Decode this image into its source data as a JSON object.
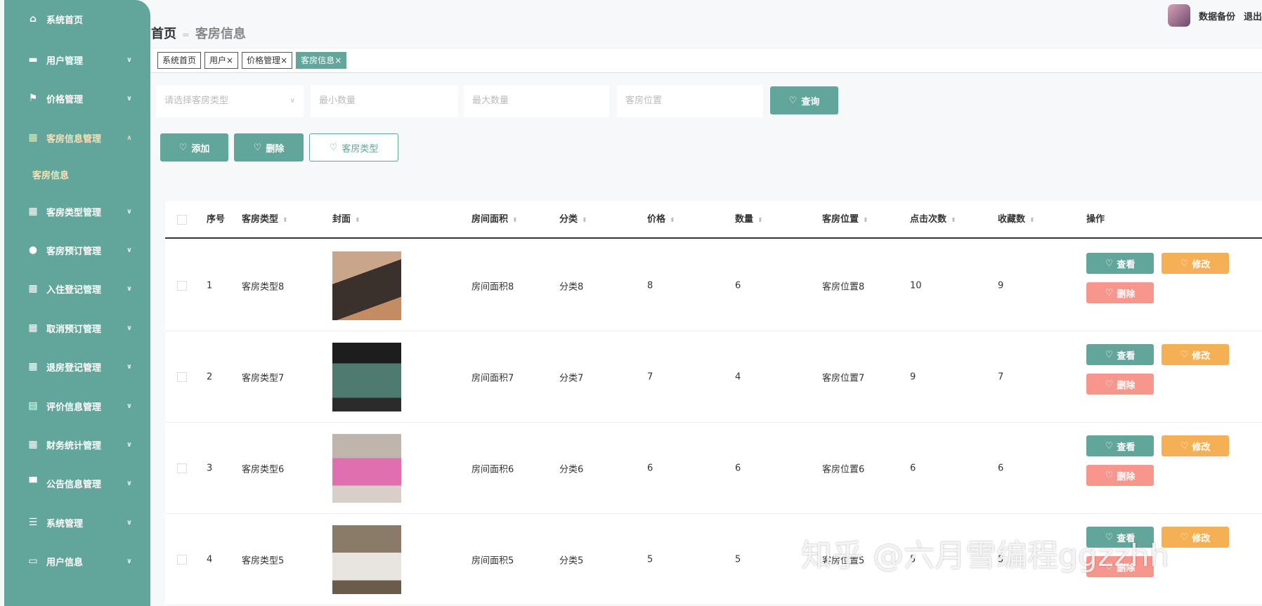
{
  "sidebar": {
    "items": [
      {
        "label": "系统首页",
        "icon": "home-icon",
        "glyph": "⌂",
        "chev": ""
      },
      {
        "label": "用户管理",
        "icon": "briefcase-icon",
        "glyph": "▬",
        "chev": "∨"
      },
      {
        "label": "价格管理",
        "icon": "flag-icon",
        "glyph": "⚑",
        "chev": "∨"
      },
      {
        "label": "客房信息管理",
        "icon": "grid-icon",
        "glyph": "▦",
        "chev": "∧",
        "open": true
      },
      {
        "label": "客房类型管理",
        "icon": "grid-icon",
        "glyph": "▦",
        "chev": "∨"
      },
      {
        "label": "客房预订管理",
        "icon": "user-icon",
        "glyph": "●",
        "chev": "∨"
      },
      {
        "label": "入住登记管理",
        "icon": "grid-icon",
        "glyph": "▦",
        "chev": "∨"
      },
      {
        "label": "取消预订管理",
        "icon": "grid-icon",
        "glyph": "▦",
        "chev": "∨"
      },
      {
        "label": "退房登记管理",
        "icon": "grid-icon",
        "glyph": "▦",
        "chev": "∨"
      },
      {
        "label": "评价信息管理",
        "icon": "clipboard-icon",
        "glyph": "▤",
        "chev": "∨"
      },
      {
        "label": "财务统计管理",
        "icon": "grid-icon",
        "glyph": "▦",
        "chev": "∨"
      },
      {
        "label": "公告信息管理",
        "icon": "printer-icon",
        "glyph": "▀",
        "chev": "∨"
      },
      {
        "label": "系统管理",
        "icon": "list-icon",
        "glyph": "☰",
        "chev": "∨"
      },
      {
        "label": "用户信息",
        "icon": "card-icon",
        "glyph": "▭",
        "chev": "∨"
      }
    ],
    "sub_item": "客房信息"
  },
  "breadcrumb": {
    "home": "首页",
    "sep": "=",
    "current": "客房信息"
  },
  "header": {
    "backup": "数据备份",
    "logout": "退出"
  },
  "tags": [
    {
      "label": "系统首页",
      "close": ""
    },
    {
      "label": "用户",
      "close": "×"
    },
    {
      "label": "价格管理",
      "close": "×"
    },
    {
      "label": "客房信息",
      "close": "×",
      "active": true
    }
  ],
  "search": {
    "type_placeholder": "请选择客房类型",
    "min_placeholder": "最小数量",
    "max_placeholder": "最大数量",
    "location_placeholder": "客房位置",
    "query": "查询"
  },
  "actions": {
    "add": "添加",
    "delete": "删除",
    "room_type": "客房类型"
  },
  "table": {
    "columns": [
      "序号",
      "客房类型",
      "封面",
      "房间面积",
      "分类",
      "价格",
      "数量",
      "客房位置",
      "点击次数",
      "收藏数",
      "操作"
    ],
    "rows": [
      {
        "no": "1",
        "type": "客房类型8",
        "area": "房间面积8",
        "cat": "分类8",
        "price": "8",
        "qty": "6",
        "loc": "客房位置8",
        "clicks": "10",
        "favs": "9"
      },
      {
        "no": "2",
        "type": "客房类型7",
        "area": "房间面积7",
        "cat": "分类7",
        "price": "7",
        "qty": "4",
        "loc": "客房位置7",
        "clicks": "9",
        "favs": "7"
      },
      {
        "no": "3",
        "type": "客房类型6",
        "area": "房间面积6",
        "cat": "分类6",
        "price": "6",
        "qty": "6",
        "loc": "客房位置6",
        "clicks": "6",
        "favs": "6"
      },
      {
        "no": "4",
        "type": "客房类型5",
        "area": "房间面积5",
        "cat": "分类5",
        "price": "5",
        "qty": "5",
        "loc": "客房位置5",
        "clicks": "5",
        "favs": "5"
      }
    ],
    "view": "查看",
    "edit": "修改",
    "del": "删除"
  },
  "watermark": "知乎 @六月雪编程ggzzhh",
  "colors": {
    "primary": "#62a59b",
    "warning": "#f5b055",
    "danger": "#f7968c"
  }
}
